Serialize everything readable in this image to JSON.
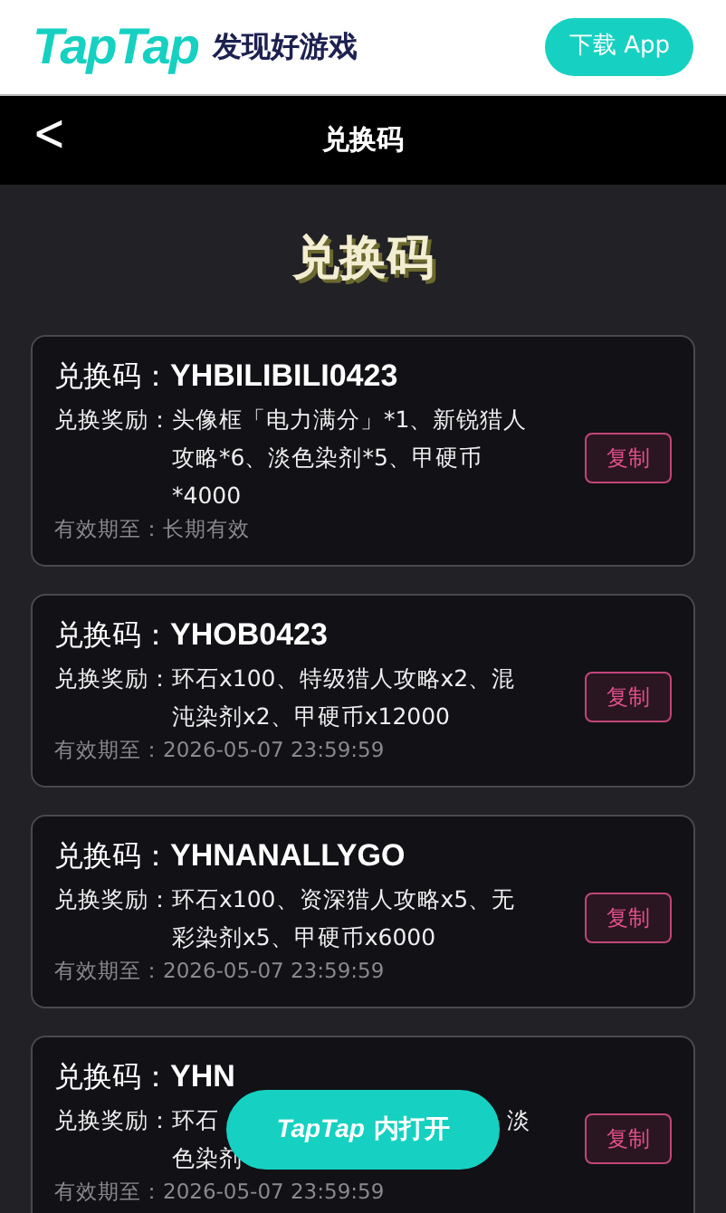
{
  "header": {
    "logo": "TapTap",
    "slogan": "发现好游戏",
    "download_button": "下载 App"
  },
  "nav": {
    "back": "<",
    "title": "兑换码"
  },
  "heading": "兑换码",
  "cards": [
    {
      "code_label": "兑换码：",
      "code": "YHBILIBILI0423",
      "reward_label": "兑换奖励：",
      "reward_parts": [
        "头像框「电力满分」*1、新锐猎人攻略*6、淡色染剂*5、甲硬币*4000"
      ],
      "expiry_label": "有效期至：",
      "expiry": "长期有效",
      "copy": "复制"
    },
    {
      "code_label": "兑换码：",
      "code": "YHOB0423",
      "reward_label": "兑换奖励：",
      "reward_parts": [
        "环石x100、特级猎人攻略x2、混沌染剂x2、甲硬币x12000"
      ],
      "expiry_label": "有效期至：",
      "expiry": "2026-05-07 23:59:59",
      "copy": "复制"
    },
    {
      "code_label": "兑换码：",
      "code": "YHNANALLYGO",
      "reward_label": "兑换奖励：",
      "reward_parts": [
        "环石x100、资深猎人攻略x5、无彩染剂x5、甲硬币x6000"
      ],
      "expiry_label": "有效期至：",
      "expiry": "2026-05-07 23:59:59",
      "copy": "复制"
    },
    {
      "code_label": "兑换码：",
      "code": "YHN",
      "reward_label": "兑换奖励：",
      "reward_parts": [
        "环石",
        "淡",
        "色染剂"
      ],
      "expiry_label": "有效期至：",
      "expiry": "2026-05-07 23:59:59",
      "copy": "复制"
    }
  ],
  "open_in_app_button": {
    "logo": "TapTap",
    "label": "内打开"
  }
}
